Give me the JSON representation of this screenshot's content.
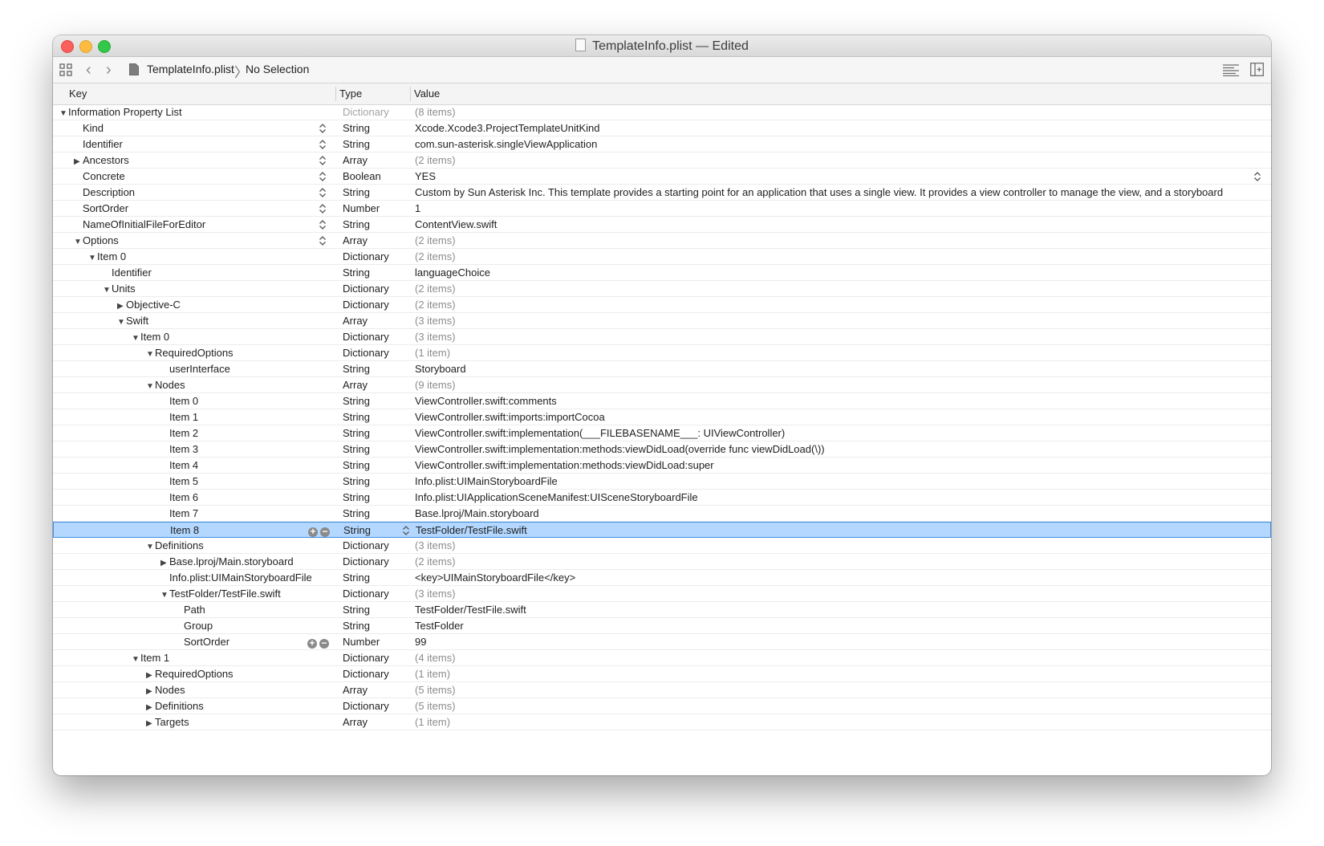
{
  "window": {
    "title": "TemplateInfo.plist — Edited"
  },
  "navbar": {
    "file": "TemplateInfo.plist",
    "separator": "〉",
    "selection": "No Selection"
  },
  "columns": {
    "key": "Key",
    "type": "Type",
    "value": "Value"
  },
  "rows": [
    {
      "key": "Information Property List",
      "type": "Dictionary",
      "value": "(8 items)",
      "level": 0,
      "tri": "open",
      "type_dim": true,
      "value_muted": true
    },
    {
      "key": "Kind",
      "type": "String",
      "value": "Xcode.Xcode3.ProjectTemplateUnitKind",
      "level": 1,
      "tri": "none",
      "stepper": true
    },
    {
      "key": "Identifier",
      "type": "String",
      "value": "com.sun-asterisk.singleViewApplication",
      "level": 1,
      "tri": "none",
      "stepper": true
    },
    {
      "key": "Ancestors",
      "type": "Array",
      "value": "(2 items)",
      "level": 1,
      "tri": "closed",
      "stepper": true,
      "value_muted": true
    },
    {
      "key": "Concrete",
      "type": "Boolean",
      "value": "YES",
      "level": 1,
      "tri": "none",
      "stepper": true,
      "value_stepper": true
    },
    {
      "key": "Description",
      "type": "String",
      "value": "Custom by Sun Asterisk Inc. This template provides a starting point for an application that uses a single view. It provides a view controller to manage the view, and a storyboard",
      "level": 1,
      "tri": "none",
      "stepper": true
    },
    {
      "key": "SortOrder",
      "type": "Number",
      "value": "1",
      "level": 1,
      "tri": "none",
      "stepper": true
    },
    {
      "key": "NameOfInitialFileForEditor",
      "type": "String",
      "value": "ContentView.swift",
      "level": 1,
      "tri": "none",
      "stepper": true
    },
    {
      "key": "Options",
      "type": "Array",
      "value": "(2 items)",
      "level": 1,
      "tri": "open",
      "stepper": true,
      "value_muted": true
    },
    {
      "key": "Item 0",
      "type": "Dictionary",
      "value": "(2 items)",
      "level": 2,
      "tri": "open",
      "value_muted": true
    },
    {
      "key": "Identifier",
      "type": "String",
      "value": "languageChoice",
      "level": 3,
      "tri": "none"
    },
    {
      "key": "Units",
      "type": "Dictionary",
      "value": "(2 items)",
      "level": 3,
      "tri": "open",
      "value_muted": true
    },
    {
      "key": "Objective-C",
      "type": "Dictionary",
      "value": "(2 items)",
      "level": 4,
      "tri": "closed",
      "value_muted": true
    },
    {
      "key": "Swift",
      "type": "Array",
      "value": "(3 items)",
      "level": 4,
      "tri": "open",
      "value_muted": true
    },
    {
      "key": "Item 0",
      "type": "Dictionary",
      "value": "(3 items)",
      "level": 5,
      "tri": "open",
      "value_muted": true
    },
    {
      "key": "RequiredOptions",
      "type": "Dictionary",
      "value": "(1 item)",
      "level": 6,
      "tri": "open",
      "value_muted": true
    },
    {
      "key": "userInterface",
      "type": "String",
      "value": "Storyboard",
      "level": 7,
      "tri": "none"
    },
    {
      "key": "Nodes",
      "type": "Array",
      "value": "(9 items)",
      "level": 6,
      "tri": "open",
      "value_muted": true
    },
    {
      "key": "Item 0",
      "type": "String",
      "value": "ViewController.swift:comments",
      "level": 7,
      "tri": "none"
    },
    {
      "key": "Item 1",
      "type": "String",
      "value": "ViewController.swift:imports:importCocoa",
      "level": 7,
      "tri": "none"
    },
    {
      "key": "Item 2",
      "type": "String",
      "value": "ViewController.swift:implementation(___FILEBASENAME___: UIViewController)",
      "level": 7,
      "tri": "none"
    },
    {
      "key": "Item 3",
      "type": "String",
      "value": "ViewController.swift:implementation:methods:viewDidLoad(override func viewDidLoad(\\))",
      "level": 7,
      "tri": "none"
    },
    {
      "key": "Item 4",
      "type": "String",
      "value": "ViewController.swift:implementation:methods:viewDidLoad:super",
      "level": 7,
      "tri": "none"
    },
    {
      "key": "Item 5",
      "type": "String",
      "value": "Info.plist:UIMainStoryboardFile",
      "level": 7,
      "tri": "none"
    },
    {
      "key": "Item 6",
      "type": "String",
      "value": "Info.plist:UIApplicationSceneManifest:UISceneStoryboardFile",
      "level": 7,
      "tri": "none"
    },
    {
      "key": "Item 7",
      "type": "String",
      "value": "Base.lproj/Main.storyboard",
      "level": 7,
      "tri": "none"
    },
    {
      "key": "Item 8",
      "type": "String",
      "value": "TestFolder/TestFile.swift",
      "level": 7,
      "tri": "none",
      "selected": true,
      "plusminus": true,
      "type_stepper": true
    },
    {
      "key": "Definitions",
      "type": "Dictionary",
      "value": "(3 items)",
      "level": 6,
      "tri": "open",
      "value_muted": true
    },
    {
      "key": "Base.lproj/Main.storyboard",
      "type": "Dictionary",
      "value": "(2 items)",
      "level": 7,
      "tri": "closed",
      "value_muted": true
    },
    {
      "key": "Info.plist:UIMainStoryboardFile",
      "type": "String",
      "value": "<key>UIMainStoryboardFile</key>",
      "level": 7,
      "tri": "none"
    },
    {
      "key": "TestFolder/TestFile.swift",
      "type": "Dictionary",
      "value": "(3 items)",
      "level": 7,
      "tri": "open",
      "value_muted": true
    },
    {
      "key": "Path",
      "type": "String",
      "value": "TestFolder/TestFile.swift",
      "level": 8,
      "tri": "none"
    },
    {
      "key": "Group",
      "type": "String",
      "value": "TestFolder",
      "level": 8,
      "tri": "none"
    },
    {
      "key": "SortOrder",
      "type": "Number",
      "value": "99",
      "level": 8,
      "tri": "none",
      "plusminus": true
    },
    {
      "key": "Item 1",
      "type": "Dictionary",
      "value": "(4 items)",
      "level": 5,
      "tri": "open",
      "value_muted": true
    },
    {
      "key": "RequiredOptions",
      "type": "Dictionary",
      "value": "(1 item)",
      "level": 6,
      "tri": "closed",
      "value_muted": true
    },
    {
      "key": "Nodes",
      "type": "Array",
      "value": "(5 items)",
      "level": 6,
      "tri": "closed",
      "value_muted": true
    },
    {
      "key": "Definitions",
      "type": "Dictionary",
      "value": "(5 items)",
      "level": 6,
      "tri": "closed",
      "value_muted": true
    },
    {
      "key": "Targets",
      "type": "Array",
      "value": "(1 item)",
      "level": 6,
      "tri": "closed",
      "value_muted": true
    }
  ]
}
